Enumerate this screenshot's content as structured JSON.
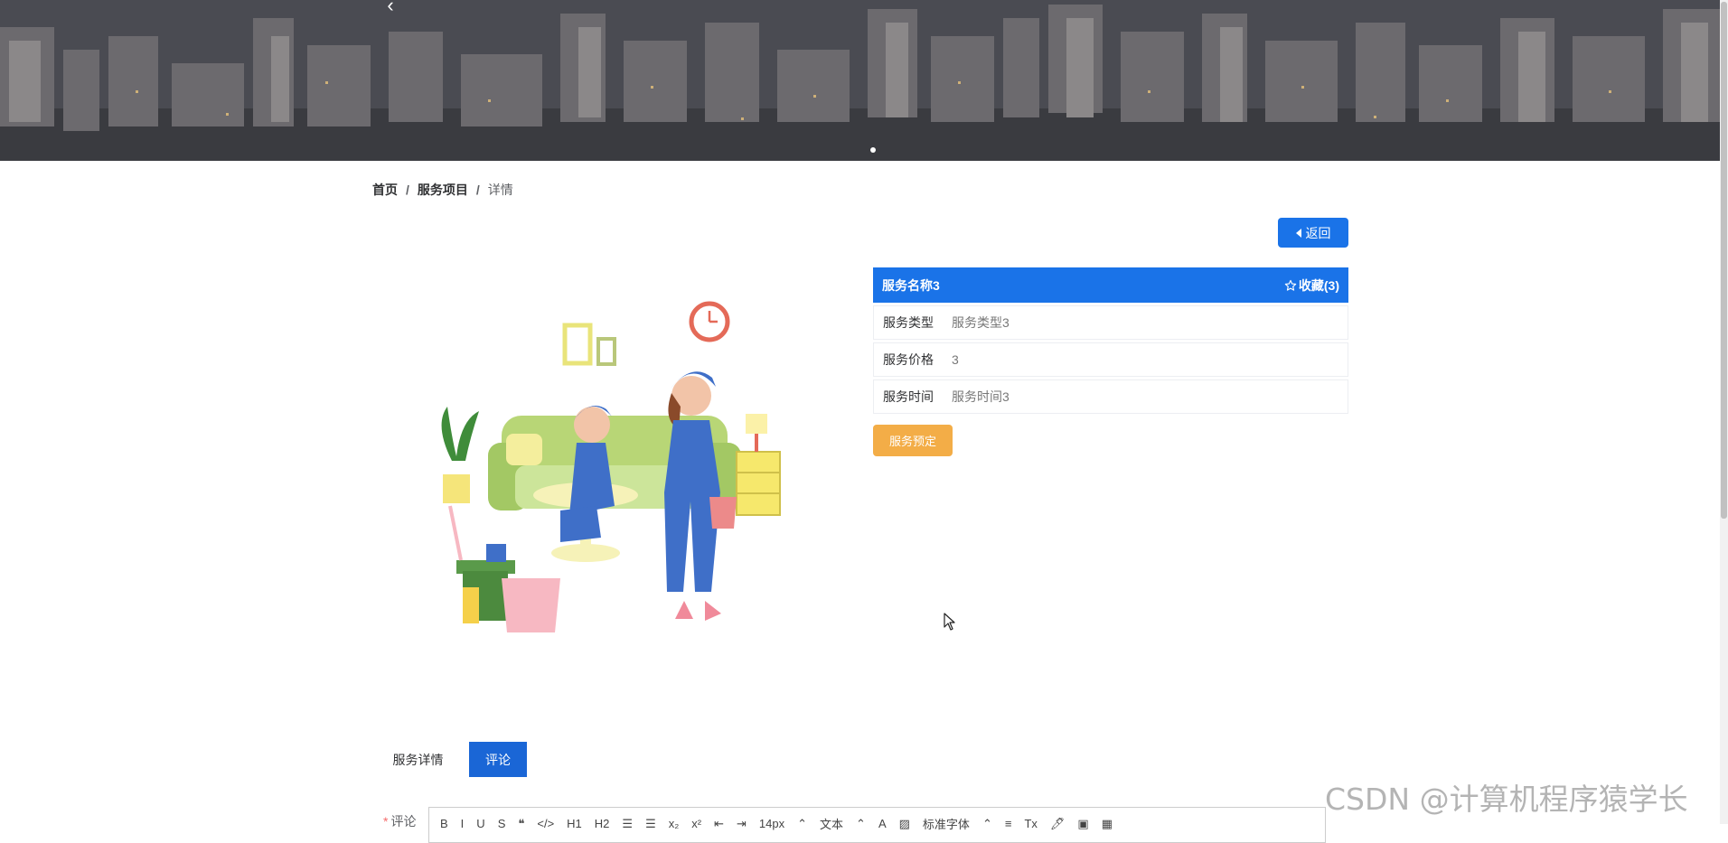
{
  "banner": {
    "prev_icon": "chevron-left-icon"
  },
  "breadcrumb": {
    "home": "首页",
    "section": "服务项目",
    "current": "详情",
    "separator": "/"
  },
  "back_button": {
    "label": "返回",
    "icon": "caret-left-icon"
  },
  "service": {
    "title": "服务名称3",
    "favorite_label": "收藏(3)",
    "favorite_icon": "star-outline-icon",
    "rows": [
      {
        "label": "服务类型",
        "value": "服务类型3"
      },
      {
        "label": "服务价格",
        "value": "3"
      },
      {
        "label": "服务时间",
        "value": "服务时间3"
      }
    ],
    "book_button": "服务预定"
  },
  "tabs": [
    {
      "label": "服务详情",
      "active": false
    },
    {
      "label": "评论",
      "active": true
    }
  ],
  "comment": {
    "required_mark": "*",
    "label": "评论",
    "toolbar": [
      "B",
      "I",
      "U",
      "S",
      "❝",
      "</>",
      "H1",
      "H2",
      "☰",
      "☰",
      "x₂",
      "x²",
      "⇤",
      "⇥",
      "14px",
      "⌃",
      "文本",
      "⌃",
      "A",
      "▨",
      "标准字体",
      "⌃",
      "≡",
      "Tx",
      "🖊",
      "▣",
      "▦"
    ]
  },
  "watermark": "CSDN @计算机程序猿学长",
  "colors": {
    "primary": "#1a73e8",
    "tab_active": "#1a66d6",
    "book": "#f3ad47"
  }
}
